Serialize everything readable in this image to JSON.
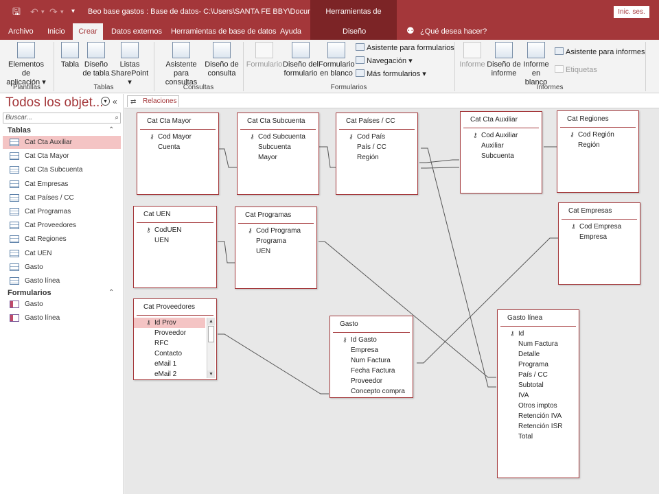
{
  "titlebar": {
    "document_title": "Beo base gastos : Base de datos- C:\\Users\\SANTA FE BBY\\Document...",
    "contextual_tools": "Herramientas de relaciones",
    "sign_in": "Inic. ses.",
    "icons": [
      "save-icon",
      "undo-icon",
      "redo-icon",
      "customize-quick-access-icon"
    ]
  },
  "tabs": {
    "archivo": "Archivo",
    "inicio": "Inicio",
    "crear": "Crear",
    "datos_externos": "Datos externos",
    "herramientas_bd": "Herramientas de base de datos",
    "ayuda": "Ayuda",
    "diseno": "Diseño",
    "tell_me": "¿Qué desea hacer?",
    "active": "Crear"
  },
  "ribbon": {
    "groups": {
      "plantillas": "Plantillas",
      "tablas": "Tablas",
      "consultas": "Consultas",
      "formularios": "Formularios",
      "informes": "Informes"
    },
    "plantillas": {
      "elementos_line1": "Elementos de",
      "elementos_line2": "aplicación ▾"
    },
    "tablas": {
      "tabla": "Tabla",
      "diseno_line1": "Diseño",
      "diseno_line2": "de tabla",
      "listas_line1": "Listas",
      "listas_line2": "SharePoint ▾"
    },
    "consultas": {
      "asistente_line1": "Asistente para",
      "asistente_line2": "consultas",
      "diseno_line1": "Diseño de",
      "diseno_line2": "consulta"
    },
    "formularios": {
      "formulario": "Formulario",
      "diseno_line1": "Diseño del",
      "diseno_line2": "formulario",
      "blanco_line1": "Formulario",
      "blanco_line2": "en blanco",
      "asistente": "Asistente para formularios",
      "navegacion": "Navegación ▾",
      "mas": "Más formularios ▾"
    },
    "informes": {
      "informe": "Informe",
      "diseno_line1": "Diseño de",
      "diseno_line2": "informe",
      "blanco_line1": "Informe",
      "blanco_line2": "en blanco",
      "asistente": "Asistente para informes",
      "etiquetas": "Etiquetas"
    }
  },
  "nav": {
    "title": "Todos los objet...",
    "search_placeholder": "Buscar...",
    "tables_header": "Tablas",
    "tables": [
      "Cat Cta Auxiliar",
      "Cat Cta Mayor",
      "Cat Cta Subcuenta",
      "Cat Empresas",
      "Cat Países / CC",
      "Cat Programas",
      "Cat Proveedores",
      "Cat Regiones",
      "Cat UEN",
      "Gasto",
      "Gasto línea"
    ],
    "selected_table": "Cat Cta Auxiliar",
    "forms_header": "Formularios",
    "forms": [
      "Gasto",
      "Gasto línea"
    ]
  },
  "document_tab": "Relaciones",
  "relationship_tables": {
    "cta_mayor": {
      "title": "Cat Cta Mayor",
      "fields": [
        "Cod Mayor",
        "Cuenta"
      ],
      "keys": [
        "Cod Mayor"
      ]
    },
    "cta_subcuenta": {
      "title": "Cat Cta Subcuenta",
      "fields": [
        "Cod Subcuenta",
        "Subcuenta",
        "Mayor"
      ],
      "keys": [
        "Cod Subcuenta"
      ]
    },
    "paises": {
      "title": "Cat Países / CC",
      "fields": [
        "Cod País",
        "País / CC",
        "Región"
      ],
      "keys": [
        "Cod País"
      ]
    },
    "cta_auxiliar": {
      "title": "Cat Cta Auxiliar",
      "fields": [
        "Cod Auxiliar",
        "Auxiliar",
        "Subcuenta"
      ],
      "keys": [
        "Cod Auxiliar"
      ]
    },
    "regiones": {
      "title": "Cat Regiones",
      "fields": [
        "Cod Región",
        "Región"
      ],
      "keys": [
        "Cod Región"
      ]
    },
    "uen": {
      "title": "Cat UEN",
      "fields": [
        "CodUEN",
        "UEN"
      ],
      "keys": [
        "CodUEN"
      ]
    },
    "programas": {
      "title": "Cat Programas",
      "fields": [
        "Cod Programa",
        "Programa",
        "UEN"
      ],
      "keys": [
        "Cod Programa"
      ]
    },
    "empresas": {
      "title": "Cat Empresas",
      "fields": [
        "Cod Empresa",
        "Empresa"
      ],
      "keys": [
        "Cod Empresa"
      ]
    },
    "proveedores": {
      "title": "Cat Proveedores",
      "fields": [
        "Id Prov",
        "Proveedor",
        "RFC",
        "Contacto",
        "eMail 1",
        "eMail 2"
      ],
      "keys": [
        "Id Prov"
      ],
      "selected": "Id Prov"
    },
    "gasto": {
      "title": "Gasto",
      "fields": [
        "Id Gasto",
        "Empresa",
        "Num Factura",
        "Fecha Factura",
        "Proveedor",
        "Concepto compra"
      ],
      "keys": [
        "Id Gasto"
      ]
    },
    "gasto_linea": {
      "title": "Gasto línea",
      "fields": [
        "Id",
        "Num Factura",
        "Detalle",
        "Programa",
        "País / CC",
        "Subtotal",
        "IVA",
        "Otros imptos",
        "Retención IVA",
        "Retención ISR",
        "Total"
      ],
      "keys": [
        "Id"
      ]
    }
  }
}
